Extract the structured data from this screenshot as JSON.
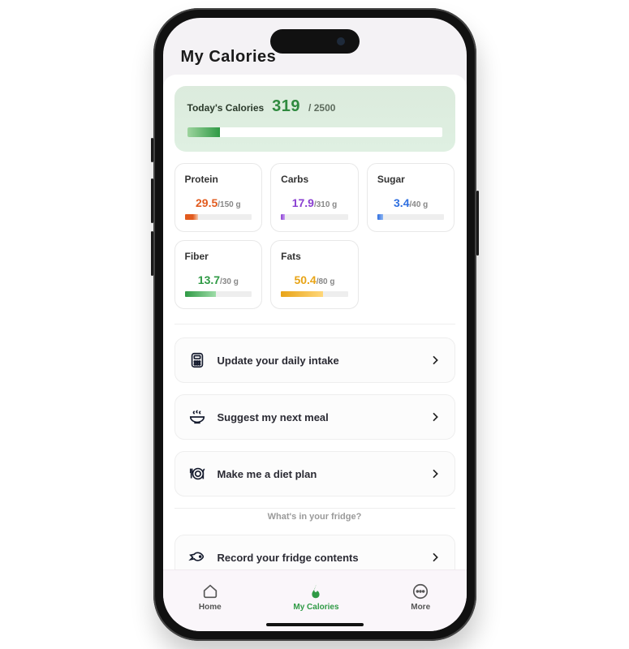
{
  "header": {
    "title": "My Calories"
  },
  "calories": {
    "label": "Today's Calories",
    "value": "319",
    "max_prefixed": "/ 2500",
    "pct": 12.8
  },
  "nutrients": [
    {
      "name": "Protein",
      "value": "29.5",
      "max": "/150 g",
      "pct": 20,
      "color": "#e25b1e",
      "grad": "linear-gradient(90deg,#e25b1e 60%,#f5c9ad)"
    },
    {
      "name": "Carbs",
      "value": "17.9",
      "max": "/310 g",
      "pct": 6,
      "color": "#8a3fd1",
      "grad": "linear-gradient(90deg,#8a3fd1,#c89ef2)"
    },
    {
      "name": "Sugar",
      "value": "3.4",
      "max": "/40 g",
      "pct": 9,
      "color": "#2f6fe0",
      "grad": "linear-gradient(90deg,#2f6fe0,#8fb6f2)"
    },
    {
      "name": "Fiber",
      "value": "13.7",
      "max": "/30 g",
      "pct": 46,
      "color": "#2f9a45",
      "grad": "linear-gradient(90deg,#2f9a45,#9edca8)"
    },
    {
      "name": "Fats",
      "value": "50.4",
      "max": "/80 g",
      "pct": 63,
      "color": "#e8a417",
      "grad": "linear-gradient(90deg,#e8a417,#ffd77a)"
    }
  ],
  "actions": [
    {
      "label": "Update your daily intake",
      "icon": "calculator-icon"
    },
    {
      "label": "Suggest my next meal",
      "icon": "bowl-icon"
    },
    {
      "label": "Make me a diet plan",
      "icon": "plate-icon"
    }
  ],
  "fridge": {
    "question": "What's in your fridge?",
    "action": {
      "label": "Record your fridge contents",
      "icon": "fish-icon"
    }
  },
  "nav": {
    "home": "Home",
    "calories": "My Calories",
    "more": "More"
  }
}
